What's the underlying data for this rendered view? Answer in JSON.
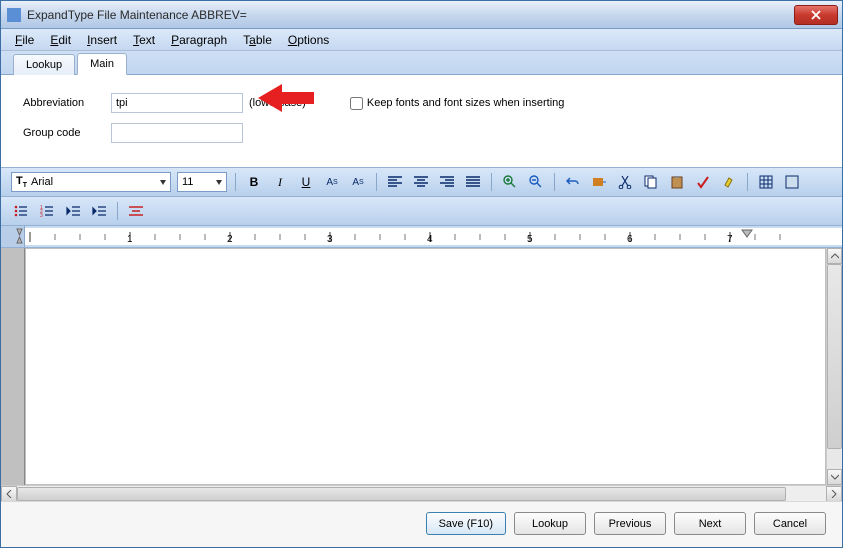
{
  "titlebar": {
    "text": "ExpandType File Maintenance  ABBREV="
  },
  "menu": {
    "file": "File",
    "edit": "Edit",
    "insert": "Insert",
    "text": "Text",
    "paragraph": "Paragraph",
    "table": "Table",
    "options": "Options"
  },
  "tabs": {
    "lookup": "Lookup",
    "main": "Main"
  },
  "form": {
    "abbr_label": "Abbreviation",
    "abbr_value": "tpi",
    "hint": "(lowercase)",
    "group_label": "Group code",
    "group_value": "",
    "keep_fonts_label": "Keep fonts and font sizes when inserting"
  },
  "toolbar": {
    "font": "Arial",
    "size": "11",
    "bold": "B",
    "italic": "I",
    "underline": "U",
    "super": "Aˢ",
    "sub": "Aₛ"
  },
  "ruler": {
    "values": [
      "1",
      "2",
      "3",
      "4",
      "5",
      "6",
      "7"
    ]
  },
  "buttons": {
    "save": "Save (F10)",
    "lookup": "Lookup",
    "prev": "Previous",
    "next": "Next",
    "cancel": "Cancel"
  }
}
